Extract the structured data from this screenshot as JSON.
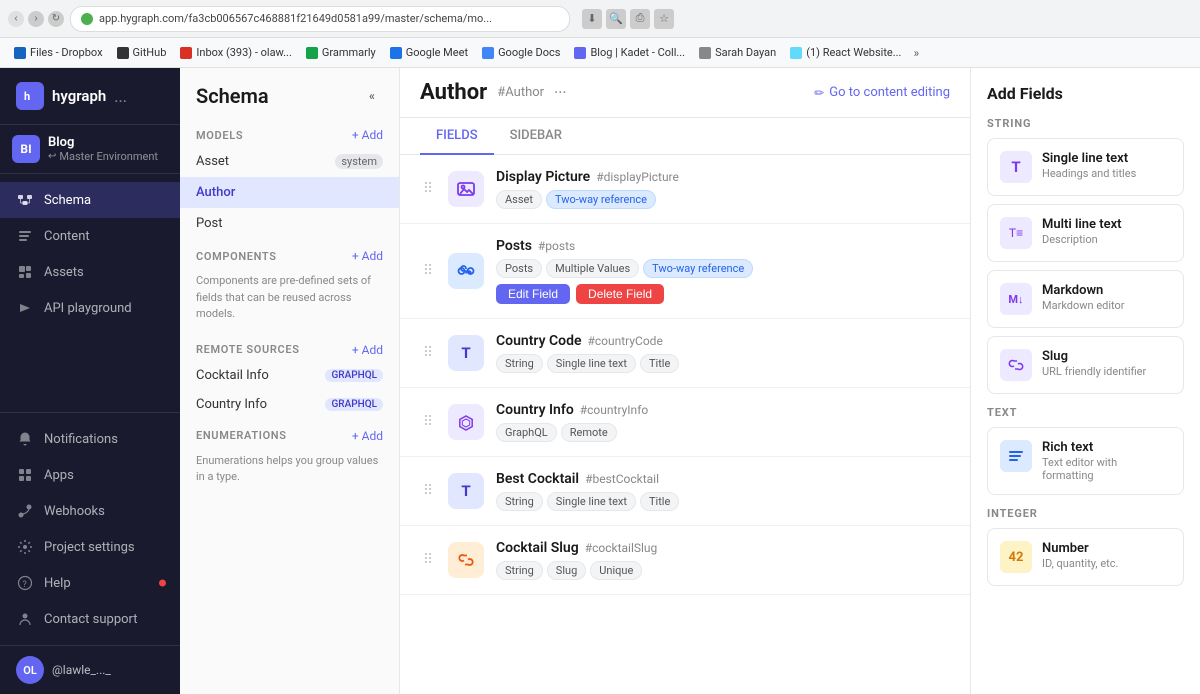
{
  "browser": {
    "url": "app.hygraph.com/fa3cb006567c468881f21649d0581a99/master/schema/mo...",
    "bookmarks": [
      {
        "name": "Files - Dropbox",
        "color": "#1565c0"
      },
      {
        "name": "GitHub",
        "color": "#333"
      },
      {
        "name": "Inbox (393) - olaw...",
        "color": "#d93025"
      },
      {
        "name": "Grammarly",
        "color": "#15a34a"
      },
      {
        "name": "Google Meet",
        "color": "#1a73e8"
      },
      {
        "name": "Google Docs",
        "color": "#4285f4"
      },
      {
        "name": "Blog | Kadet - Coll...",
        "color": "#6366f1"
      },
      {
        "name": "Sarah Dayan",
        "color": "#888"
      },
      {
        "name": "(1) React Website...",
        "color": "#61dafb"
      }
    ]
  },
  "app": {
    "logo": "hygraph",
    "logo_dots": "...",
    "logo_letter": "h"
  },
  "env": {
    "badge": "BI",
    "name": "Blog",
    "sub": "Master Environment",
    "sub_icon": "↩"
  },
  "nav": {
    "items": [
      {
        "id": "schema",
        "label": "Schema",
        "icon": "schema"
      },
      {
        "id": "content",
        "label": "Content",
        "icon": "content"
      },
      {
        "id": "assets",
        "label": "Assets",
        "icon": "assets"
      },
      {
        "id": "api-playground",
        "label": "API playground",
        "icon": "api"
      }
    ],
    "bottom_items": [
      {
        "id": "notifications",
        "label": "Notifications",
        "icon": "bell",
        "dot": false
      },
      {
        "id": "apps",
        "label": "Apps",
        "icon": "grid",
        "dot": false
      },
      {
        "id": "webhooks",
        "label": "Webhooks",
        "icon": "webhook",
        "dot": false
      },
      {
        "id": "project-settings",
        "label": "Project settings",
        "icon": "settings",
        "dot": false
      },
      {
        "id": "help",
        "label": "Help",
        "icon": "help",
        "dot": true
      },
      {
        "id": "contact-support",
        "label": "Contact support",
        "icon": "support",
        "dot": false
      }
    ],
    "user": "@lawle_..._"
  },
  "schema": {
    "title": "Schema",
    "sections": {
      "models": {
        "label": "MODELS",
        "add_label": "+ Add",
        "items": [
          {
            "name": "Asset",
            "badge": "system"
          },
          {
            "name": "Author",
            "badge": null
          },
          {
            "name": "Post",
            "badge": null
          }
        ]
      },
      "components": {
        "label": "COMPONENTS",
        "add_label": "+ Add",
        "desc": "Components are pre-defined sets of fields that can be reused across models."
      },
      "remote_sources": {
        "label": "REMOTE SOURCES",
        "add_label": "+ Add",
        "items": [
          {
            "name": "Cocktail Info",
            "badge": "GRAPHQL"
          },
          {
            "name": "Country Info",
            "badge": "GRAPHQL"
          }
        ]
      },
      "enumerations": {
        "label": "ENUMERATIONS",
        "add_label": "+ Add",
        "desc": "Enumerations helps you group values in a type."
      }
    }
  },
  "author": {
    "title": "Author",
    "id": "#Author",
    "more": "···",
    "go_to_editing": "Go to content editing",
    "tabs": [
      {
        "id": "fields",
        "label": "FIELDS"
      },
      {
        "id": "sidebar",
        "label": "SIDEBAR"
      }
    ],
    "active_tab": "fields",
    "fields": [
      {
        "id": "display-picture",
        "name": "Display Picture",
        "hash": "#displayPicture",
        "icon": "paperclip",
        "icon_style": "purple",
        "tags": [
          "Asset",
          "Two-way reference"
        ],
        "tag_styles": [
          "gray",
          "blue"
        ],
        "actions": []
      },
      {
        "id": "posts",
        "name": "Posts",
        "hash": "#posts",
        "icon": "link",
        "icon_style": "blue",
        "tags": [
          "Posts",
          "Multiple Values",
          "Two-way reference"
        ],
        "tag_styles": [
          "gray",
          "gray",
          "blue"
        ],
        "actions": [
          "Edit Field",
          "Delete Field"
        ]
      },
      {
        "id": "country-code",
        "name": "Country Code",
        "hash": "#countryCode",
        "icon": "T",
        "icon_style": "indigo",
        "tags": [
          "String",
          "Single line text",
          "Title"
        ],
        "tag_styles": [
          "gray",
          "gray",
          "gray"
        ],
        "actions": []
      },
      {
        "id": "country-info",
        "name": "Country Info",
        "hash": "#countryInfo",
        "icon": "graphql",
        "icon_style": "purple",
        "tags": [
          "GraphQL",
          "Remote"
        ],
        "tag_styles": [
          "gray",
          "gray"
        ],
        "actions": []
      },
      {
        "id": "best-cocktail",
        "name": "Best Cocktail",
        "hash": "#bestCocktail",
        "icon": "T",
        "icon_style": "indigo",
        "tags": [
          "String",
          "Single line text",
          "Title"
        ],
        "tag_styles": [
          "gray",
          "gray",
          "gray"
        ],
        "actions": []
      },
      {
        "id": "cocktail-slug",
        "name": "Cocktail Slug",
        "hash": "#cocktailSlug",
        "icon": "link2",
        "icon_style": "orange",
        "tags": [
          "String",
          "Slug",
          "Unique"
        ],
        "tag_styles": [
          "gray",
          "gray",
          "gray"
        ],
        "actions": []
      }
    ]
  },
  "add_fields": {
    "title": "Add Fields",
    "sections": {
      "string": {
        "label": "STRING",
        "items": [
          {
            "id": "single-line-text",
            "name": "Single line text",
            "desc": "Headings and titles",
            "icon_style": "string",
            "icon": "T"
          },
          {
            "id": "multi-line-text",
            "name": "Multi line text",
            "desc": "Description",
            "icon_style": "string",
            "icon": "T≡"
          },
          {
            "id": "markdown",
            "name": "Markdown",
            "desc": "Markdown editor",
            "icon_style": "string",
            "icon": "M↓"
          },
          {
            "id": "slug",
            "name": "Slug",
            "desc": "URL friendly identifier",
            "icon_style": "string",
            "icon": "#"
          }
        ]
      },
      "text": {
        "label": "TEXT",
        "items": [
          {
            "id": "rich-text",
            "name": "Rich text",
            "desc": "Text editor with formatting",
            "icon_style": "text",
            "icon": "≡"
          }
        ]
      },
      "integer": {
        "label": "INTEGER",
        "items": [
          {
            "id": "number",
            "name": "Number",
            "desc": "ID, quantity, etc.",
            "icon_style": "integer",
            "icon": "42"
          }
        ]
      }
    }
  }
}
